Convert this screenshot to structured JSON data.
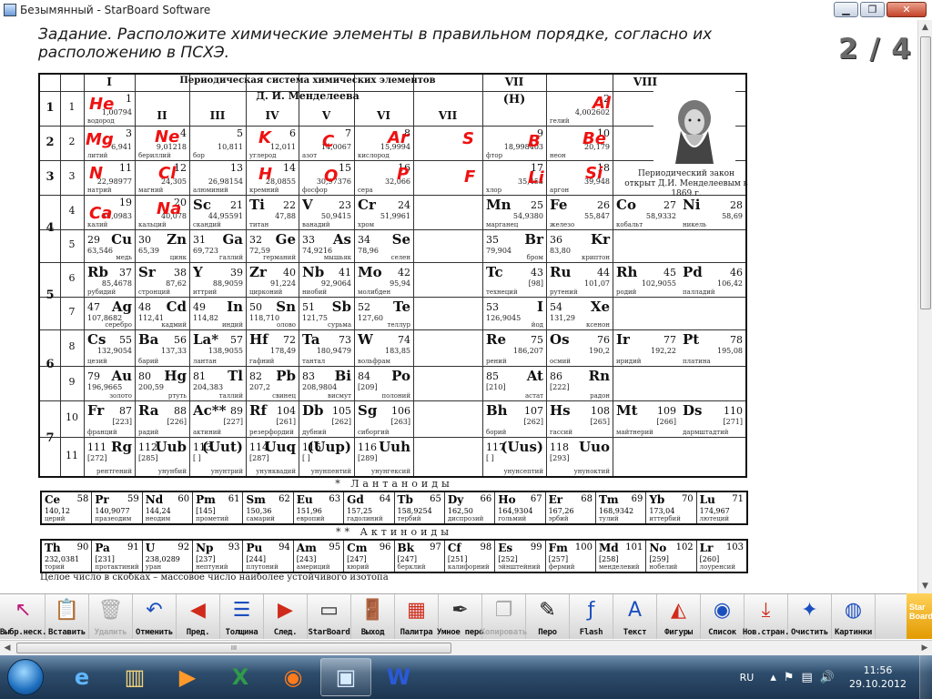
{
  "window": {
    "title": "Безымянный - StarBoard Software",
    "controls": {
      "minimize": "▁",
      "maximize": "❐",
      "close": "✕"
    }
  },
  "page": {
    "task_text": "Задание. Расположите химические элементы в правильном порядке, согласно их расположению в ПСХЭ.",
    "counter": "2 / 4"
  },
  "ptable": {
    "title_line1": "Периодическая система химических элементов",
    "title_line2": "Д. И. Менделеева",
    "group_headers": [
      "I",
      "II",
      "III",
      "IV",
      "V",
      "VI",
      "VII",
      "VIII"
    ],
    "group_vii_h": "(H)",
    "law_text": "Периодический закон открыт Д.И. Менделеевым в 1869 г.",
    "periods": [
      "1",
      "2",
      "3",
      "4",
      "5",
      "6",
      "7"
    ],
    "rows": [
      "1",
      "2",
      "3",
      "4",
      "5",
      "6",
      "7",
      "8",
      "9",
      "10",
      "11"
    ],
    "elements": [
      {
        "num": "1",
        "mass": "1,00794",
        "name": "водород"
      },
      {
        "num": "2",
        "mass": "4,002602",
        "name": "гелий"
      },
      {
        "num": "3",
        "mass": "6,941",
        "name": "литий"
      },
      {
        "num": "4",
        "mass": "9,01218",
        "name": "бериллий"
      },
      {
        "num": "5",
        "mass": "10,811",
        "name": "бор"
      },
      {
        "num": "6",
        "mass": "12,011",
        "name": "углерод"
      },
      {
        "num": "7",
        "mass": "14,0067",
        "name": "азот"
      },
      {
        "num": "8",
        "mass": "15,9994",
        "name": "кислород"
      },
      {
        "num": "9",
        "mass": "18,998403",
        "name": "фтор"
      },
      {
        "num": "10",
        "mass": "20,179",
        "name": "неон"
      },
      {
        "num": "11",
        "mass": "22,98977",
        "name": "натрий"
      },
      {
        "num": "12",
        "mass": "24,305",
        "name": "магний"
      },
      {
        "num": "13",
        "mass": "26,98154",
        "name": "алюминий"
      },
      {
        "num": "14",
        "mass": "28,0855",
        "name": "кремний"
      },
      {
        "num": "15",
        "mass": "30,97376",
        "name": "фосфор"
      },
      {
        "num": "16",
        "mass": "32,066",
        "name": "сера"
      },
      {
        "num": "17",
        "mass": "35,453",
        "name": "хлор"
      },
      {
        "num": "18",
        "mass": "39,948",
        "name": "аргон"
      },
      {
        "num": "19",
        "mass": "39,0983",
        "name": "калий"
      },
      {
        "num": "20",
        "mass": "40,078",
        "name": "кальций"
      },
      {
        "sym": "Sc",
        "num": "21",
        "mass": "44,95591",
        "name": "скандий"
      },
      {
        "sym": "Ti",
        "num": "22",
        "mass": "47,88",
        "name": "титан"
      },
      {
        "sym": "V",
        "num": "23",
        "mass": "50,9415",
        "name": "ванадий"
      },
      {
        "sym": "Cr",
        "num": "24",
        "mass": "51,9961",
        "name": "хром"
      },
      {
        "sym": "Mn",
        "num": "25",
        "mass": "54,9380",
        "name": "марганец"
      },
      {
        "sym": "Fe",
        "num": "26",
        "mass": "55,847",
        "name": "железо"
      },
      {
        "sym": "Co",
        "num": "27",
        "mass": "58,9332",
        "name": "кобальт"
      },
      {
        "sym": "Ni",
        "num": "28",
        "mass": "58,69",
        "name": "никель"
      },
      {
        "sym": "Cu",
        "num": "29",
        "mass": "63,546",
        "name": "медь"
      },
      {
        "sym": "Zn",
        "num": "30",
        "mass": "65,39",
        "name": "цинк"
      },
      {
        "sym": "Ga",
        "num": "31",
        "mass": "69,723",
        "name": "галлий"
      },
      {
        "sym": "Ge",
        "num": "32",
        "mass": "72,59",
        "name": "германий"
      },
      {
        "sym": "As",
        "num": "33",
        "mass": "74,9216",
        "name": "мышьяк"
      },
      {
        "sym": "Se",
        "num": "34",
        "mass": "78,96",
        "name": "селен"
      },
      {
        "sym": "Br",
        "num": "35",
        "mass": "79,904",
        "name": "бром"
      },
      {
        "sym": "Kr",
        "num": "36",
        "mass": "83,80",
        "name": "криптон"
      },
      {
        "sym": "Rb",
        "num": "37",
        "mass": "85,4678",
        "name": "рубидий"
      },
      {
        "sym": "Sr",
        "num": "38",
        "mass": "87,62",
        "name": "стронций"
      },
      {
        "sym": "Y",
        "num": "39",
        "mass": "88,9059",
        "name": "иттрий"
      },
      {
        "sym": "Zr",
        "num": "40",
        "mass": "91,224",
        "name": "цирконий"
      },
      {
        "sym": "Nb",
        "num": "41",
        "mass": "92,9064",
        "name": "ниобий"
      },
      {
        "sym": "Mo",
        "num": "42",
        "mass": "95,94",
        "name": "молибден"
      },
      {
        "sym": "Tc",
        "num": "43",
        "mass": "[98]",
        "name": "технеций"
      },
      {
        "sym": "Ru",
        "num": "44",
        "mass": "101,07",
        "name": "рутений"
      },
      {
        "sym": "Rh",
        "num": "45",
        "mass": "102,9055",
        "name": "родий"
      },
      {
        "sym": "Pd",
        "num": "46",
        "mass": "106,42",
        "name": "палладий"
      },
      {
        "sym": "Ag",
        "num": "47",
        "mass": "107,8682",
        "name": "серебро"
      },
      {
        "sym": "Cd",
        "num": "48",
        "mass": "112,41",
        "name": "кадмий"
      },
      {
        "sym": "In",
        "num": "49",
        "mass": "114,82",
        "name": "индий"
      },
      {
        "sym": "Sn",
        "num": "50",
        "mass": "118,710",
        "name": "олово"
      },
      {
        "sym": "Sb",
        "num": "51",
        "mass": "121,75",
        "name": "сурьма"
      },
      {
        "sym": "Te",
        "num": "52",
        "mass": "127,60",
        "name": "теллур"
      },
      {
        "sym": "I",
        "num": "53",
        "mass": "126,9045",
        "name": "йод"
      },
      {
        "sym": "Xe",
        "num": "54",
        "mass": "131,29",
        "name": "ксенон"
      },
      {
        "sym": "Cs",
        "num": "55",
        "mass": "132,9054",
        "name": "цезий"
      },
      {
        "sym": "Ba",
        "num": "56",
        "mass": "137,33",
        "name": "барий"
      },
      {
        "sym": "La*",
        "num": "57",
        "mass": "138,9055",
        "name": "лантан"
      },
      {
        "sym": "Hf",
        "num": "72",
        "mass": "178,49",
        "name": "гафний"
      },
      {
        "sym": "Ta",
        "num": "73",
        "mass": "180,9479",
        "name": "тантал"
      },
      {
        "sym": "W",
        "num": "74",
        "mass": "183,85",
        "name": "вольфрам"
      },
      {
        "sym": "Re",
        "num": "75",
        "mass": "186,207",
        "name": "рений"
      },
      {
        "sym": "Os",
        "num": "76",
        "mass": "190,2",
        "name": "осмий"
      },
      {
        "sym": "Ir",
        "num": "77",
        "mass": "192,22",
        "name": "иридий"
      },
      {
        "sym": "Pt",
        "num": "78",
        "mass": "195,08",
        "name": "платина"
      },
      {
        "sym": "Au",
        "num": "79",
        "mass": "196,9665",
        "name": "золото"
      },
      {
        "sym": "Hg",
        "num": "80",
        "mass": "200,59",
        "name": "ртуть"
      },
      {
        "sym": "Tl",
        "num": "81",
        "mass": "204,383",
        "name": "таллий"
      },
      {
        "sym": "Pb",
        "num": "82",
        "mass": "207,2",
        "name": "свинец"
      },
      {
        "sym": "Bi",
        "num": "83",
        "mass": "208,9804",
        "name": "висмут"
      },
      {
        "sym": "Po",
        "num": "84",
        "mass": "[209]",
        "name": "полоний"
      },
      {
        "sym": "At",
        "num": "85",
        "mass": "[210]",
        "name": "астат"
      },
      {
        "sym": "Rn",
        "num": "86",
        "mass": "[222]",
        "name": "радон"
      },
      {
        "sym": "Fr",
        "num": "87",
        "mass": "[223]",
        "name": "франций"
      },
      {
        "sym": "Ra",
        "num": "88",
        "mass": "[226]",
        "name": "радий"
      },
      {
        "sym": "Ac**",
        "num": "89",
        "mass": "[227]",
        "name": "актиний"
      },
      {
        "sym": "Rf",
        "num": "104",
        "mass": "[261]",
        "name": "резерфордий"
      },
      {
        "sym": "Db",
        "num": "105",
        "mass": "[262]",
        "name": "дубний"
      },
      {
        "sym": "Sg",
        "num": "106",
        "mass": "[263]",
        "name": "сиборгий"
      },
      {
        "sym": "Bh",
        "num": "107",
        "mass": "[262]",
        "name": "борий"
      },
      {
        "sym": "Hs",
        "num": "108",
        "mass": "[265]",
        "name": "гассий"
      },
      {
        "sym": "Mt",
        "num": "109",
        "mass": "[266]",
        "name": "майтнерий"
      },
      {
        "sym": "Ds",
        "num": "110",
        "mass": "[271]",
        "name": "дармштадтий"
      },
      {
        "sym": "Rg",
        "num": "111",
        "mass": "[272]",
        "name": "рентгений"
      },
      {
        "sym": "Uub",
        "num": "112",
        "mass": "[285]",
        "name": "унунбий"
      },
      {
        "sym": "(Uut)",
        "num": "113",
        "mass": "[ ]",
        "name": "унунтрий"
      },
      {
        "sym": "Uuq",
        "num": "114",
        "mass": "[287]",
        "name": "унунквадий"
      },
      {
        "sym": "(Uup)",
        "num": "115",
        "mass": "[ ]",
        "name": "унунпентий"
      },
      {
        "sym": "Uuh",
        "num": "116",
        "mass": "[289]",
        "name": "унунгексий"
      },
      {
        "sym": "(Uus)",
        "num": "117",
        "mass": "[ ]",
        "name": "унунсептий"
      },
      {
        "sym": "Uuo",
        "num": "118",
        "mass": "[293]",
        "name": "унуноктий"
      }
    ],
    "placed_labels": [
      "He",
      "Al",
      "Mg",
      "Ne",
      "K",
      "C",
      "Ar",
      "S",
      "B",
      "Be",
      "N",
      "Cl",
      "H",
      "O",
      "P",
      "F",
      "Li",
      "Si",
      "Ca",
      "Na"
    ],
    "label_color": "#ee1111"
  },
  "lanthanides": {
    "title": "*  Лантаноиды",
    "items": [
      {
        "sym": "Ce",
        "num": "58",
        "mass": "140,12",
        "name": "церий"
      },
      {
        "sym": "Pr",
        "num": "59",
        "mass": "140,9077",
        "name": "празеодим"
      },
      {
        "sym": "Nd",
        "num": "60",
        "mass": "144,24",
        "name": "неодим"
      },
      {
        "sym": "Pm",
        "num": "61",
        "mass": "[145]",
        "name": "прометий"
      },
      {
        "sym": "Sm",
        "num": "62",
        "mass": "150,36",
        "name": "самарий"
      },
      {
        "sym": "Eu",
        "num": "63",
        "mass": "151,96",
        "name": "европий"
      },
      {
        "sym": "Gd",
        "num": "64",
        "mass": "157,25",
        "name": "гадолиний"
      },
      {
        "sym": "Tb",
        "num": "65",
        "mass": "158,9254",
        "name": "тербий"
      },
      {
        "sym": "Dy",
        "num": "66",
        "mass": "162,50",
        "name": "диспрозий"
      },
      {
        "sym": "Ho",
        "num": "67",
        "mass": "164,9304",
        "name": "гольмий"
      },
      {
        "sym": "Er",
        "num": "68",
        "mass": "167,26",
        "name": "эрбий"
      },
      {
        "sym": "Tm",
        "num": "69",
        "mass": "168,9342",
        "name": "тулий"
      },
      {
        "sym": "Yb",
        "num": "70",
        "mass": "173,04",
        "name": "иттербий"
      },
      {
        "sym": "Lu",
        "num": "71",
        "mass": "174,967",
        "name": "лютеций"
      }
    ]
  },
  "actinides": {
    "title": "**  Актиноиды",
    "items": [
      {
        "sym": "Th",
        "num": "90",
        "mass": "232,0381",
        "name": "торий"
      },
      {
        "sym": "Pa",
        "num": "91",
        "mass": "[231]",
        "name": "протактиний"
      },
      {
        "sym": "U",
        "num": "92",
        "mass": "238,0289",
        "name": "уран"
      },
      {
        "sym": "Np",
        "num": "93",
        "mass": "[237]",
        "name": "нептуний"
      },
      {
        "sym": "Pu",
        "num": "94",
        "mass": "[244]",
        "name": "плутоний"
      },
      {
        "sym": "Am",
        "num": "95",
        "mass": "[243]",
        "name": "америций"
      },
      {
        "sym": "Cm",
        "num": "96",
        "mass": "[247]",
        "name": "кюрий"
      },
      {
        "sym": "Bk",
        "num": "97",
        "mass": "[247]",
        "name": "берклий"
      },
      {
        "sym": "Cf",
        "num": "98",
        "mass": "[251]",
        "name": "калифорний"
      },
      {
        "sym": "Es",
        "num": "99",
        "mass": "[252]",
        "name": "эйнштейний"
      },
      {
        "sym": "Fm",
        "num": "100",
        "mass": "[257]",
        "name": "фермий"
      },
      {
        "sym": "Md",
        "num": "101",
        "mass": "[258]",
        "name": "менделевий"
      },
      {
        "sym": "No",
        "num": "102",
        "mass": "[259]",
        "name": "нобелий"
      },
      {
        "sym": "Lr",
        "num": "103",
        "mass": "[260]",
        "name": "лоуренсий"
      }
    ]
  },
  "footnote": "Целое число в скобках – массовое число наиболее устойчивого изотопа",
  "toolbar": [
    {
      "label": "Выбр.неск.",
      "icon": "multi-select-icon",
      "glyph": "↖",
      "color": "#c0187a",
      "disabled": false
    },
    {
      "label": "Вставить",
      "icon": "paste-icon",
      "glyph": "📋",
      "color": "#222",
      "disabled": false
    },
    {
      "label": "Удалить",
      "icon": "delete-icon",
      "glyph": "🗑",
      "color": "#aaa",
      "disabled": true
    },
    {
      "label": "Отменить",
      "icon": "undo-icon",
      "glyph": "↶",
      "color": "#1b4fbf",
      "disabled": false
    },
    {
      "label": "Пред.",
      "icon": "previous-page-icon",
      "glyph": "◀",
      "color": "#d02a1a",
      "disabled": false
    },
    {
      "label": "Толщина",
      "icon": "thickness-icon",
      "glyph": "☰",
      "color": "#1b4fbf",
      "disabled": false
    },
    {
      "label": "След.",
      "icon": "next-page-icon",
      "glyph": "▶",
      "color": "#d02a1a",
      "disabled": false
    },
    {
      "label": "StarBoard",
      "icon": "starboard-icon",
      "glyph": "▭",
      "color": "#333",
      "disabled": false
    },
    {
      "label": "Выход",
      "icon": "exit-icon",
      "glyph": "🚪",
      "color": "#6a3b12",
      "disabled": false
    },
    {
      "label": "Палитра",
      "icon": "palette-icon",
      "glyph": "▦",
      "color": "#d02a1a",
      "disabled": false
    },
    {
      "label": "Умное перо",
      "icon": "smart-pen-icon",
      "glyph": "✒",
      "color": "#333",
      "disabled": false
    },
    {
      "label": "Копировать",
      "icon": "copy-icon",
      "glyph": "❐",
      "color": "#aaa",
      "disabled": true
    },
    {
      "label": "Перо",
      "icon": "pen-icon",
      "glyph": "✎",
      "color": "#111",
      "disabled": false
    },
    {
      "label": "Flash",
      "icon": "flash-icon",
      "glyph": "ƒ",
      "color": "#1b4fbf",
      "disabled": false
    },
    {
      "label": "Текст",
      "icon": "text-icon",
      "glyph": "A",
      "color": "#1b4fbf",
      "disabled": false
    },
    {
      "label": "Фигуры",
      "icon": "shapes-icon",
      "glyph": "◭",
      "color": "#d02a1a",
      "disabled": false
    },
    {
      "label": "Список",
      "icon": "list-icon",
      "glyph": "◉",
      "color": "#1b4fbf",
      "disabled": false
    },
    {
      "label": "Нов.стран.",
      "icon": "new-page-icon",
      "glyph": "⤓",
      "color": "#d02a1a",
      "disabled": false
    },
    {
      "label": "Очистить",
      "icon": "clear-icon",
      "glyph": "✦",
      "color": "#1b4fbf",
      "disabled": false
    },
    {
      "label": "Картинки",
      "icon": "pictures-icon",
      "glyph": "◍",
      "color": "#1b4fbf",
      "disabled": false
    }
  ],
  "starboard_logo": "Star Board",
  "hscroll_grip": "III",
  "taskbar": {
    "apps": [
      {
        "icon": "internet-explorer-icon",
        "glyph": "e",
        "color": "#5fb7ff"
      },
      {
        "icon": "file-explorer-icon",
        "glyph": "▥",
        "color": "#f3d27a"
      },
      {
        "icon": "media-player-icon",
        "glyph": "▶",
        "color": "#ff9a2a"
      },
      {
        "icon": "excel-icon",
        "glyph": "X",
        "color": "#2f9a4a"
      },
      {
        "icon": "firefox-icon",
        "glyph": "◉",
        "color": "#ff7a1a"
      },
      {
        "icon": "starboard-app-icon",
        "glyph": "▣",
        "color": "#d7ecff"
      },
      {
        "icon": "word-icon",
        "glyph": "W",
        "color": "#2b5ad9"
      }
    ],
    "active_app": 5,
    "language": "RU",
    "time": "11:56",
    "date": "29.10.2012"
  }
}
